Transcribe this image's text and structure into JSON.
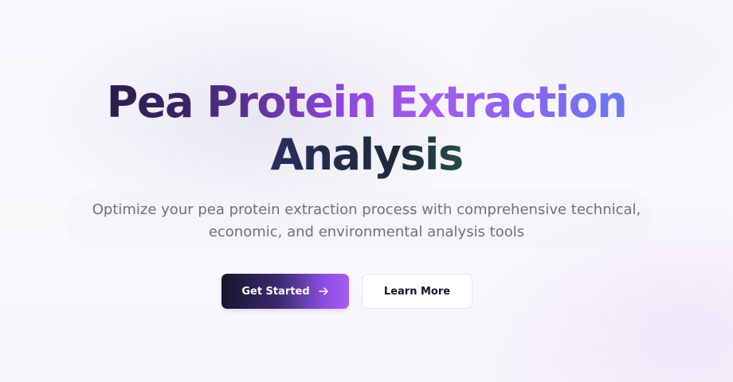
{
  "hero": {
    "title_line_1": "Pea Protein Extraction",
    "title_line_2": "Analysis",
    "subtitle": "Optimize your pea protein extraction process with comprehensive technical, economic, and environmental analysis tools"
  },
  "actions": {
    "primary_label": "Get Started",
    "primary_icon": "arrow-right-icon",
    "secondary_label": "Learn More"
  },
  "colors": {
    "title_gradient_start": "#1a1838",
    "title_gradient_mid": "#a55cf0",
    "title_gradient_end": "#5b8af0",
    "title_line_2_end": "#3bbf7a",
    "subtitle_text": "#6b7080",
    "primary_button_start": "#16162e",
    "primary_button_end": "#a65cf2",
    "secondary_button_text": "#14142a"
  }
}
